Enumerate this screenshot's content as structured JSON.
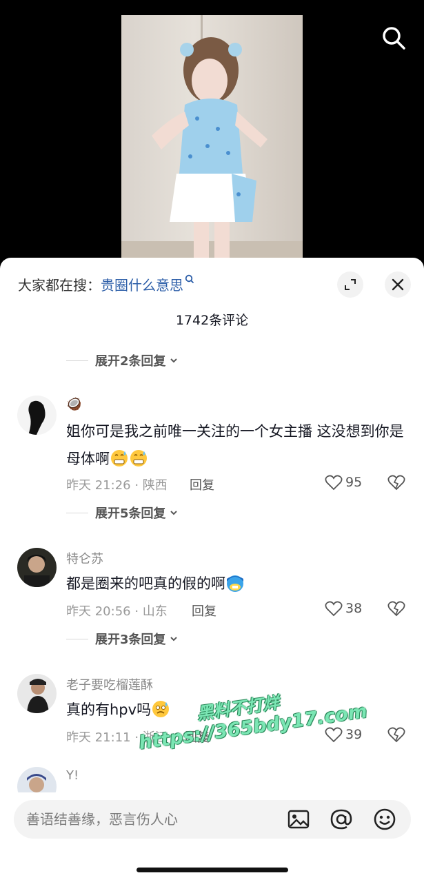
{
  "header": {
    "trend_prefix": "大家都在搜：",
    "trend_query": "贵圈什么意思",
    "comment_count": "1742条评论"
  },
  "expand_rows": [
    {
      "label": "展开2条回复"
    },
    {
      "label": "展开5条回复"
    },
    {
      "label": "展开3条回复"
    }
  ],
  "comments": [
    {
      "name": "🥥",
      "text": "姐你可是我之前唯一关注的一个女主播 这没想到你是母体啊",
      "time": "昨天 21:26 · 陕西",
      "reply": "回复",
      "likes": "95"
    },
    {
      "name": "特仑苏",
      "text": "都是圈来的吧真的假的啊",
      "time": "昨天 20:56 · 山东",
      "reply": "回复",
      "likes": "38"
    },
    {
      "name": "老子要吃榴莲酥",
      "text": "真的有hpv吗",
      "time": "昨天 21:11 · 浙江",
      "reply": "回复",
      "likes": "39"
    },
    {
      "name": "Y!"
    }
  ],
  "input": {
    "placeholder": "善语结善缘，恶言伤人心"
  },
  "watermark": {
    "line1": "黑料不打烊",
    "line2": "https://365bdy17.com"
  },
  "colors": {
    "link": "#2c5ea8",
    "text": "#161823",
    "muted": "#999999"
  }
}
